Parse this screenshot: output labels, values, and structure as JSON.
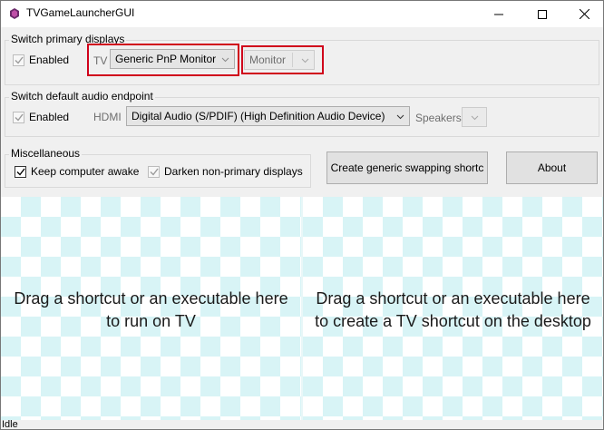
{
  "window": {
    "title": "TVGameLauncherGUI"
  },
  "displays": {
    "group_label": "Switch primary displays",
    "enabled_label": "Enabled",
    "enabled_checked": true,
    "tv_label": "TV",
    "tv_device": "Generic PnP Monitor",
    "monitor_device": "Monitor"
  },
  "audio": {
    "group_label": "Switch default audio endpoint",
    "enabled_label": "Enabled",
    "enabled_checked": true,
    "hdmi_label": "HDMI",
    "hdmi_device": "Digital Audio (S/PDIF) (High Definition Audio Device)",
    "speakers_label": "Speakers",
    "speakers_device": ""
  },
  "misc": {
    "group_label": "Miscellaneous",
    "keep_awake_label": "Keep computer awake",
    "keep_awake_checked": true,
    "darken_label": "Darken non-primary displays",
    "darken_checked": true
  },
  "buttons": {
    "create_shortcut": "Create generic swapping shortc",
    "about": "About"
  },
  "dropzones": {
    "left_line1": "Drag a shortcut or an executable here",
    "left_line2": "to run on TV",
    "right_line1": "Drag a shortcut or an executable here",
    "right_line2": "to create a TV shortcut on the desktop"
  },
  "status": {
    "text": "Idle"
  },
  "colors": {
    "highlight": "#d0021b",
    "checker": "#d8f4f6",
    "button_face": "#e1e1e1"
  }
}
